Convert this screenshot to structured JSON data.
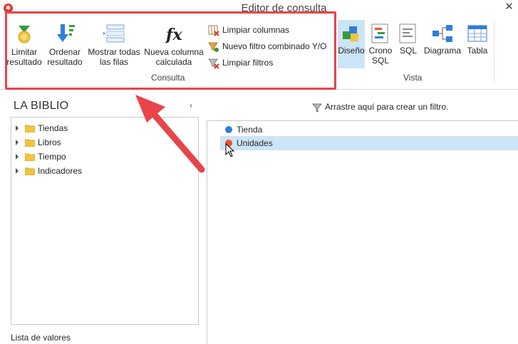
{
  "window": {
    "title": "Editor de consulta",
    "app_icon": "app-logo-icon",
    "close_glyph": "✕"
  },
  "ribbon": {
    "consulta": {
      "group_label": "Consulta",
      "buttons": [
        {
          "line1": "Limitar",
          "line2": "resultado",
          "icon": "limit-icon"
        },
        {
          "line1": "Ordenar",
          "line2": "resultado",
          "icon": "sort-icon"
        },
        {
          "line1": "Mostrar todas",
          "line2": "las filas",
          "icon": "rows-icon"
        },
        {
          "line1": "Nueva columna",
          "line2": "calculada",
          "icon": "function-icon"
        }
      ],
      "small_buttons": [
        {
          "label": "Limpiar columnas",
          "icon": "clear-columns-icon"
        },
        {
          "label": "Nuevo filtro combinado Y/O",
          "icon": "combined-filter-icon"
        },
        {
          "label": "Limpiar filtros",
          "icon": "clear-filters-icon"
        }
      ]
    },
    "vista": {
      "group_label": "Vista",
      "buttons": [
        {
          "line1": "Diseño",
          "line2": "",
          "icon": "design-icon",
          "active": true
        },
        {
          "line1": "Crono",
          "line2": "SQL",
          "icon": "sql-chrono-icon"
        },
        {
          "line1": "SQL",
          "line2": "",
          "icon": "sql-icon"
        },
        {
          "line1": "Diagrama",
          "line2": "",
          "icon": "diagram-icon"
        },
        {
          "line1": "Tabla",
          "line2": "",
          "icon": "table-icon"
        }
      ]
    }
  },
  "left_panel": {
    "title": "LA BIBLIO",
    "collapse_glyph": "‹",
    "tree": [
      {
        "label": "Tiendas"
      },
      {
        "label": "Libros"
      },
      {
        "label": "Tiempo"
      },
      {
        "label": "Indicadores"
      }
    ],
    "footer": "Lista de valores"
  },
  "filter_area": {
    "hint": "Arrastre aquí para crear un filtro."
  },
  "fields": [
    {
      "label": "Tienda",
      "color": "#2f7fd9",
      "selected": false
    },
    {
      "label": "Unidades",
      "color": "#e8542a",
      "selected": true
    }
  ],
  "colors": {
    "highlight": "#e8444a",
    "selection": "#cce4f7",
    "accent": "#2f7fd9"
  }
}
